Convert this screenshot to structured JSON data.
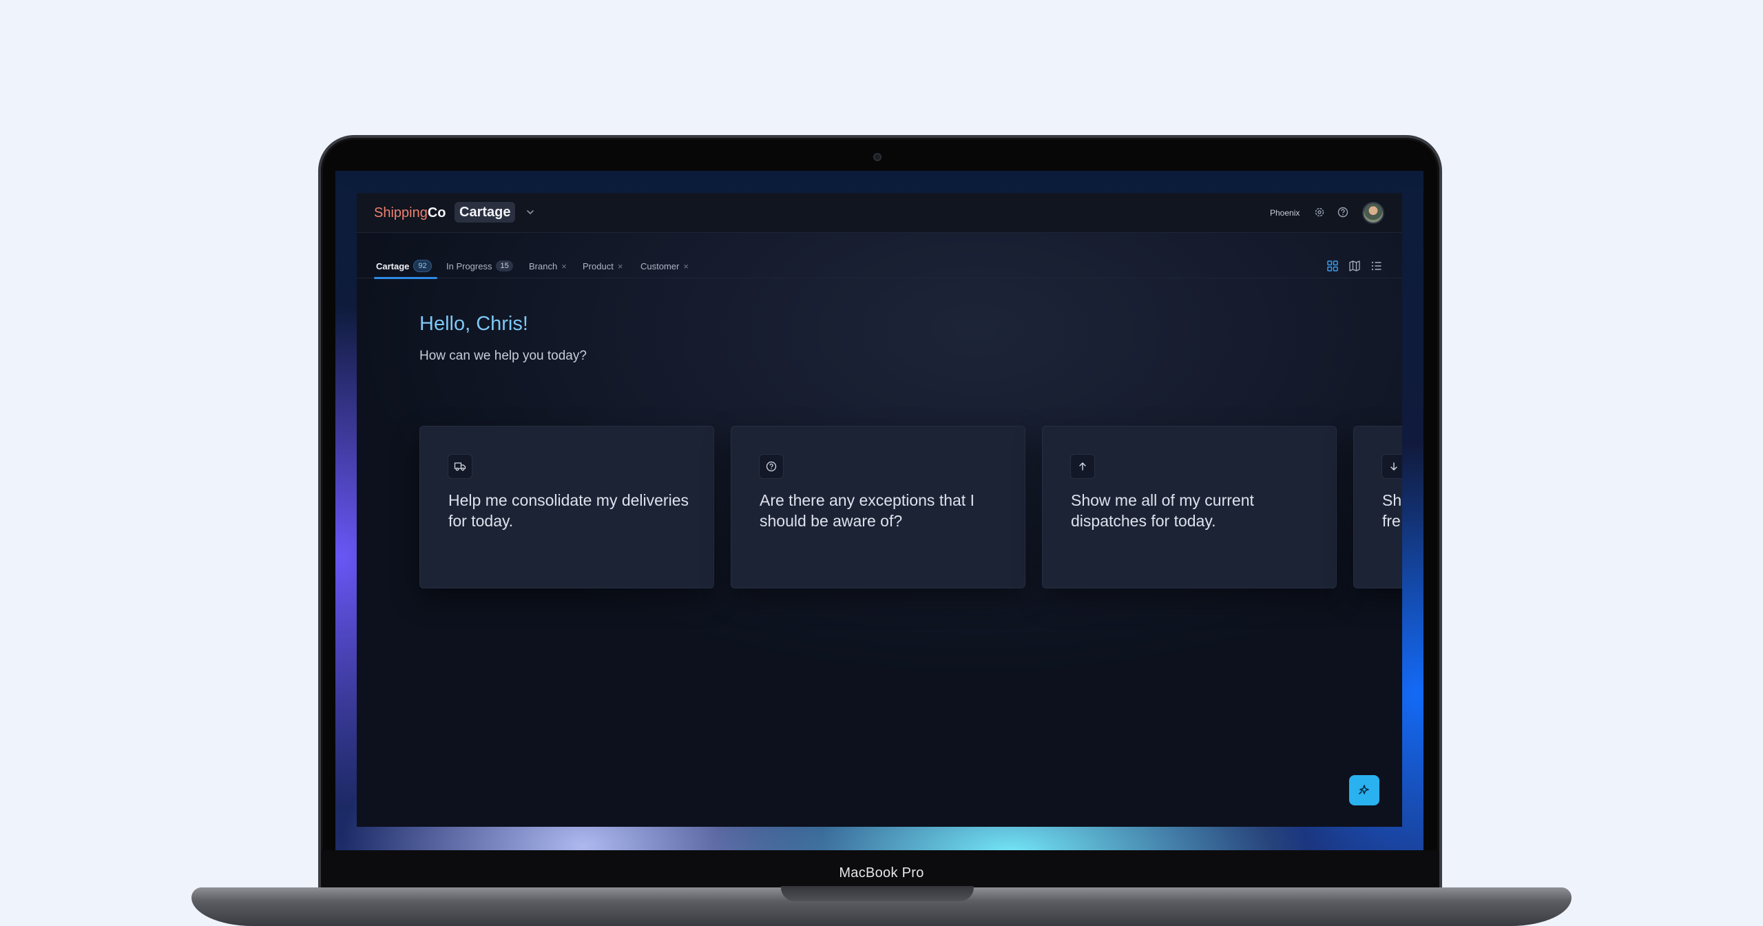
{
  "device": {
    "label": "MacBook Pro"
  },
  "header": {
    "brand_part1": "Shipping",
    "brand_part2": "Co",
    "module": "Cartage",
    "location": "Phoenix"
  },
  "tabs": [
    {
      "label": "Cartage",
      "count": "92",
      "active": true
    },
    {
      "label": "In Progress",
      "count": "15"
    },
    {
      "label": "Branch",
      "close": "×"
    },
    {
      "label": "Product",
      "close": "×"
    },
    {
      "label": "Customer",
      "close": "×"
    }
  ],
  "views": [
    "grid-view-icon",
    "map-view-icon",
    "list-view-icon"
  ],
  "main": {
    "greeting": "Hello, Chris!",
    "subtitle": "How can we help you today?"
  },
  "cards": [
    {
      "icon": "truck-icon",
      "text": "Help me consolidate my deliveries for today."
    },
    {
      "icon": "question-circle-icon",
      "text": "Are there any exceptions that I should be aware of?"
    },
    {
      "icon": "arrow-up-icon",
      "text": "Show me all of my current dispatches for today."
    },
    {
      "icon": "arrow-down-icon",
      "text": "Sh fre"
    }
  ],
  "colors": {
    "accent": "#2ab1ef",
    "brand": "#f0806f",
    "greeting": "#7ec8f6"
  }
}
